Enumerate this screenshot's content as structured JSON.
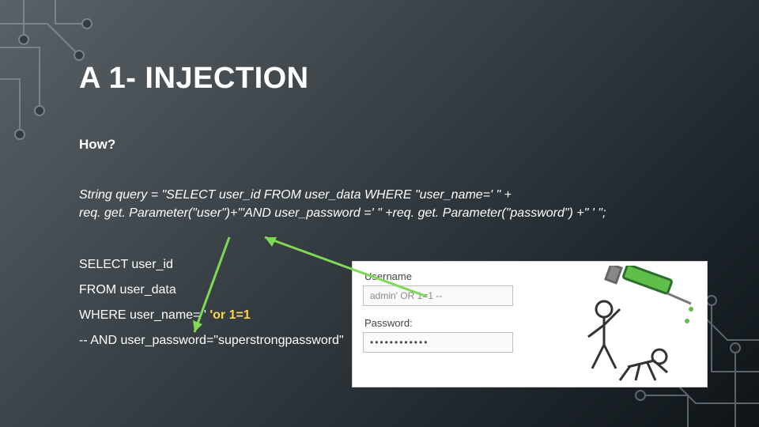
{
  "title": "A 1- INJECTION",
  "how": "How?",
  "code": {
    "line1": "String query = \"SELECT user_id FROM user_data WHERE \"user_name=' \" +",
    "line2": "req. get. Parameter(\"user\")+\"'AND user_password =' \"  +req. get. Parameter(\"password\") +\" ' \";"
  },
  "sql": {
    "l1": "SELECT user_id",
    "l2": "FROM user_data",
    "l3a": "WHERE user_name= '",
    "l3b": " 'or 1=1",
    "l4": "-- AND user_password=\"superstrongpassword\""
  },
  "form": {
    "usernameLabel": "Username",
    "usernameValue": "admin' OR 1=1 --",
    "passwordLabel": "Password:",
    "passwordValue": "••••••••••••"
  }
}
